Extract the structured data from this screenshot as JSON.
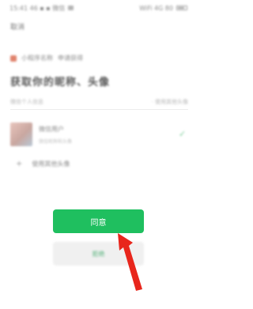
{
  "status_bar": {
    "left_text": "15:41 46 ▪ ▪ 微信",
    "right_text": "WiFi 4G 80"
  },
  "header": {
    "close_label": "取消"
  },
  "app": {
    "name": "小程序名称",
    "request_label": "申请获得"
  },
  "main": {
    "title": "获取你的昵称、头像",
    "subtitle": "微信个人信息",
    "subtitle_right": "·  使用其他头像"
  },
  "profile": {
    "name": "微信用户",
    "detail": "微信昵称和头像"
  },
  "other_option": {
    "label": "使用其他头像"
  },
  "buttons": {
    "agree": "同意",
    "reject": "拒绝"
  },
  "colors": {
    "primary_green": "#1fbf5f",
    "arrow_red": "#e8261c"
  },
  "icons": {
    "check": "check-icon",
    "plus": "plus-icon",
    "arrow": "red-pointer-arrow"
  }
}
